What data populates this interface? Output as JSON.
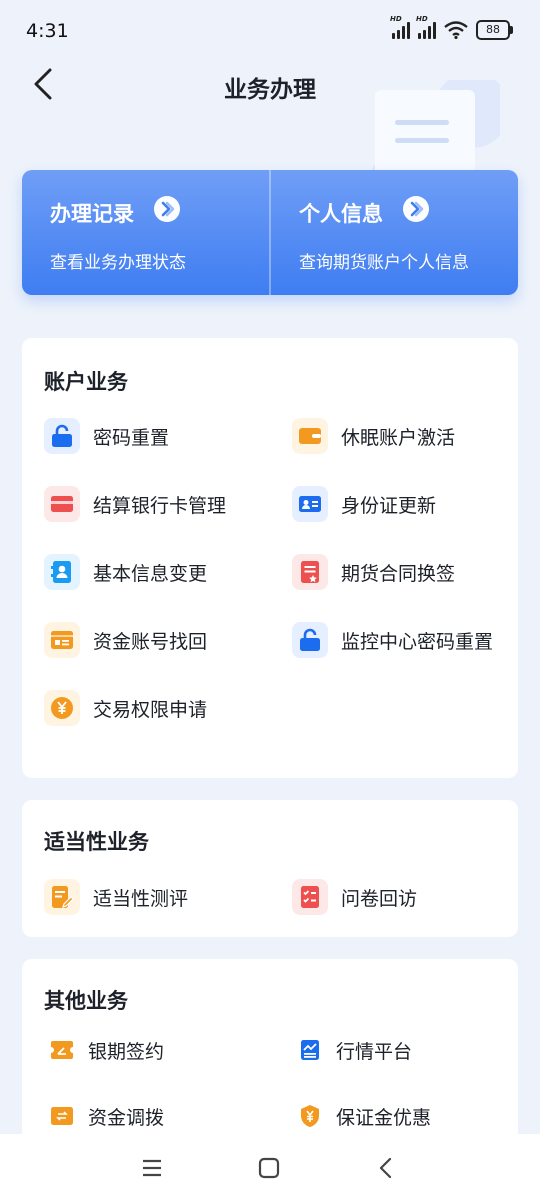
{
  "status_bar": {
    "time": "4:31",
    "signal1_label": "HD",
    "signal2_label": "HD",
    "battery": "88"
  },
  "header": {
    "title": "业务办理"
  },
  "banner": {
    "left": {
      "title": "办理记录",
      "subtitle": "查看业务办理状态"
    },
    "right": {
      "title": "个人信息",
      "subtitle": "查询期货账户个人信息"
    }
  },
  "account": {
    "title": "账户业务",
    "items": [
      {
        "label": "密码重置",
        "icon": "lock-icon"
      },
      {
        "label": "休眠账户激活",
        "icon": "wallet-icon"
      },
      {
        "label": "结算银行卡管理",
        "icon": "bank-card-icon"
      },
      {
        "label": "身份证更新",
        "icon": "id-card-icon"
      },
      {
        "label": "基本信息变更",
        "icon": "contact-icon"
      },
      {
        "label": "期货合同换签",
        "icon": "contract-icon"
      },
      {
        "label": "资金账号找回",
        "icon": "account-card-icon"
      },
      {
        "label": "监控中心密码重置",
        "icon": "lock-icon"
      },
      {
        "label": "交易权限申请",
        "icon": "yuan-icon"
      }
    ]
  },
  "suitability": {
    "title": "适当性业务",
    "items": [
      {
        "label": "适当性测评",
        "icon": "edit-doc-icon"
      },
      {
        "label": "问卷回访",
        "icon": "checklist-icon"
      }
    ]
  },
  "other": {
    "title": "其他业务",
    "items": [
      {
        "label": "银期签约",
        "icon": "sign-ticket-icon"
      },
      {
        "label": "行情平台",
        "icon": "market-chart-icon"
      },
      {
        "label": "资金调拨",
        "icon": "transfer-icon"
      },
      {
        "label": "保证金优惠",
        "icon": "shield-yuan-icon"
      }
    ]
  },
  "colors": {
    "accent": "#3f7df2",
    "orange": "#f29a1f",
    "red": "#ee4f4f",
    "background": "#eef3fb"
  }
}
